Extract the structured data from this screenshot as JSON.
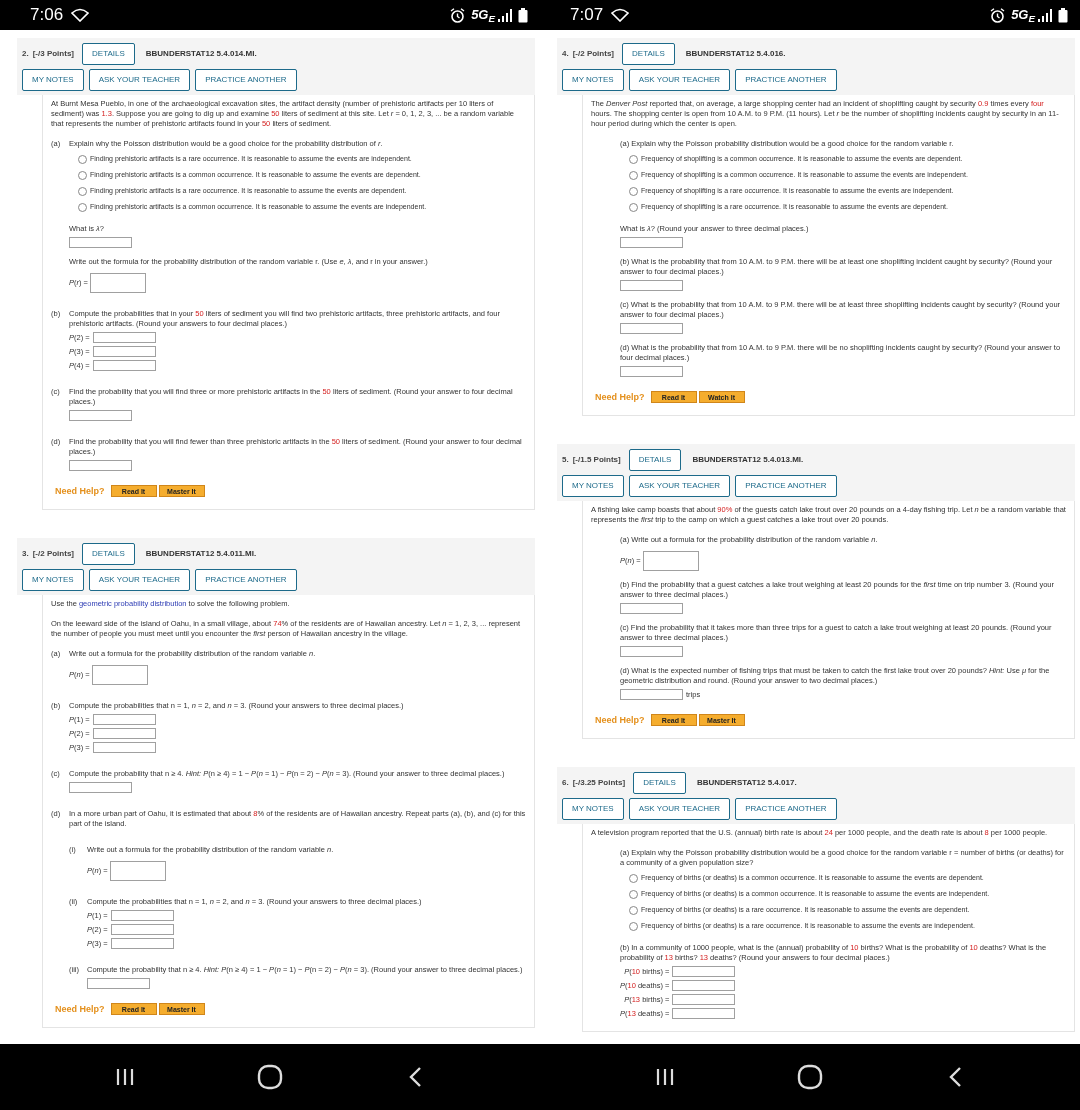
{
  "columns": [
    {
      "status_bar": {
        "time": "7:06",
        "network": "5G$_{E}$"
      },
      "problems": [
        {
          "number": "2.",
          "points": "[-/3 Points]",
          "details": "DETAILS",
          "code": "BBUNDERSTAT12 5.4.014.MI.",
          "buttons": [
            "MY NOTES",
            "ASK YOUR TEACHER",
            "PRACTICE ANOTHER"
          ],
          "intro": [
            [
              "At Burnt Mesa Pueblo, in one of the archaeological excavation sites, the artifact density (number of prehistoric artifacts per 10 liters of sediment) was ",
              {
                "kind": "red",
                "text": "1.3"
              },
              ". Suppose you are going to dig up and examine ",
              {
                "kind": "red",
                "text": "50"
              },
              " liters of sediment at this site. Let *r* = 0, 1, 2, 3, ... be a random variable that represents the number of prehistoric artifacts found in your ",
              {
                "kind": "red",
                "text": "50"
              },
              " liters of sediment."
            ]
          ],
          "items": [
            {
              "kind": "part",
              "label": "(a)",
              "items": [
                {
                  "kind": "para",
                  "text": "Explain why the Poisson distribution would be a good choice for the probability distribution of *r*."
                },
                {
                  "kind": "radios",
                  "options": [
                    {
                      "text": "Finding prehistoric artifacts is a rare occurrence. It is reasonable to assume the events are independent.",
                      "selected": false
                    },
                    {
                      "text": "Finding prehistoric artifacts is a common occurrence. It is reasonable to assume the events are dependent.",
                      "selected": false
                    },
                    {
                      "text": "Finding prehistoric artifacts is a rare occurrence. It is reasonable to assume the events are dependent.",
                      "selected": false
                    },
                    {
                      "text": "Finding prehistoric artifacts is a common occurrence. It is reasonable to assume the events are independent.",
                      "selected": false
                    }
                  ]
                },
                {
                  "kind": "para",
                  "text": "What is *λ*?"
                },
                {
                  "kind": "field"
                },
                {
                  "kind": "para",
                  "text": "Write out the formula for the probability distribution of the random variable r. (Use *e*, *λ*, and r in your answer.)"
                },
                {
                  "kind": "formula",
                  "prefix": "*P*(*r*) ="
                }
              ]
            },
            {
              "kind": "part",
              "label": "(b)",
              "items": [
                {
                  "kind": "para",
                  "text": [
                    "Compute the probabilities that in your ",
                    {
                      "kind": "red",
                      "text": "50"
                    },
                    " liters of sediment you will find two prehistoric artifacts, three prehistoric artifacts, and four prehistoric artifacts. (Round your answers to four decimal places.)"
                  ]
                },
                {
                  "kind": "fields",
                  "rows": [
                    "*P*(2) =",
                    "*P*(3) =",
                    "*P*(4) ="
                  ]
                }
              ]
            },
            {
              "kind": "part",
              "label": "(c)",
              "items": [
                {
                  "kind": "para",
                  "text": [
                    "Find the probability that you will find three or more prehistoric artifacts in the ",
                    {
                      "kind": "red",
                      "text": "50"
                    },
                    " liters of sediment. (Round your answer to four decimal places.)"
                  ]
                },
                {
                  "kind": "field"
                }
              ]
            },
            {
              "kind": "part",
              "label": "(d)",
              "items": [
                {
                  "kind": "para",
                  "text": [
                    "Find the probability that you will find fewer than three prehistoric artifacts in the ",
                    {
                      "kind": "red",
                      "text": "50"
                    },
                    " liters of sediment. (Round your answer to four decimal places.)"
                  ]
                },
                {
                  "kind": "field"
                }
              ]
            }
          ],
          "help": {
            "label": "Need Help?",
            "buttons": [
              "Read It",
              "Master It"
            ]
          }
        },
        {
          "number": "3.",
          "points": "[-/2 Points]",
          "details": "DETAILS",
          "code": "BBUNDERSTAT12 5.4.011.MI.",
          "buttons": [
            "MY NOTES",
            "ASK YOUR TEACHER",
            "PRACTICE ANOTHER"
          ],
          "intro": [
            [
              "Use the ",
              {
                "kind": "link",
                "text": "geometric probability distribution"
              },
              " to solve the following problem."
            ],
            [
              "On the leeward side of the island of Oahu, in a small village, about ",
              {
                "kind": "red",
                "text": "74"
              },
              "% of the residents are of Hawaiian ancestry. Let *n* = 1, 2, 3, ... represent the number of people you must meet until you encounter the *first* person of Hawaiian ancestry in the village."
            ]
          ],
          "items": [
            {
              "kind": "part",
              "label": "(a)",
              "items": [
                {
                  "kind": "para",
                  "text": "Write out a formula for the probability distribution of the random variable *n*."
                },
                {
                  "kind": "formula",
                  "prefix": "*P*(*n*) ="
                }
              ]
            },
            {
              "kind": "part",
              "label": "(b)",
              "items": [
                {
                  "kind": "para",
                  "text": "Compute the probabilities that n = 1, *n* = 2, and *n* = 3. (Round your answers to three decimal places.)"
                },
                {
                  "kind": "fields",
                  "rows": [
                    "*P*(1) =",
                    "*P*(2) =",
                    "*P*(3) ="
                  ]
                }
              ]
            },
            {
              "kind": "part",
              "label": "(c)",
              "items": [
                {
                  "kind": "para",
                  "text": "Compute the probability that n ≥ 4. *Hint:* *P*(n ≥ 4) = 1 − *P*(*n* = 1) − *P*(n = 2) − *P*(*n* = 3). (Round your answer to three decimal places.)"
                },
                {
                  "kind": "field"
                }
              ]
            },
            {
              "kind": "part",
              "label": "(d)",
              "items": [
                {
                  "kind": "para",
                  "text": [
                    "In a more urban part of Oahu, it is estimated that about ",
                    {
                      "kind": "red",
                      "text": "8"
                    },
                    "% of the residents are of Hawaiian ancestry. Repeat parts (a), (b), and (c) for this part of the island."
                  ]
                },
                {
                  "kind": "part",
                  "label": "(i)",
                  "items": [
                    {
                      "kind": "para",
                      "text": "Write out a formula for the probability distribution of the random variable *n*."
                    },
                    {
                      "kind": "formula",
                      "prefix": "*P*(*n*) ="
                    }
                  ]
                },
                {
                  "kind": "part",
                  "label": "(ii)",
                  "items": [
                    {
                      "kind": "para",
                      "text": "Compute the probabilities that n = 1, *n* = 2, and *n* = 3. (Round your answers to three decimal places.)"
                    },
                    {
                      "kind": "fields",
                      "rows": [
                        "*P*(1) =",
                        "*P*(2) =",
                        "*P*(3) ="
                      ]
                    }
                  ]
                },
                {
                  "kind": "part",
                  "label": "(iii)",
                  "items": [
                    {
                      "kind": "para",
                      "text": "Compute the probability that n ≥ 4. *Hint:* *P*(n ≥ 4) = 1 − *P*(*n* = 1) − *P*(n = 2) − *P*(*n* = 3). (Round your answer to three decimal places.)"
                    },
                    {
                      "kind": "field"
                    }
                  ]
                }
              ]
            }
          ],
          "help": {
            "label": "Need Help?",
            "buttons": [
              "Read It",
              "Master It"
            ]
          }
        }
      ]
    },
    {
      "status_bar": {
        "time": "7:07",
        "network": "5G$_{E}$"
      },
      "problems": [
        {
          "number": "4.",
          "points": "[-/2 Points]",
          "details": "DETAILS",
          "code": "BBUNDERSTAT12 5.4.016.",
          "buttons": [
            "MY NOTES",
            "ASK YOUR TEACHER",
            "PRACTICE ANOTHER"
          ],
          "intro": [
            [
              "The *Denver Post* reported that, on average, a large shopping center had an incident of shoplifting caught by security ",
              {
                "kind": "red",
                "text": "0.9"
              },
              " times every ",
              {
                "kind": "red",
                "text": "four"
              },
              " hours. The shopping center is open from 10 A.M. to 9 P.M. (11 hours). Let *r* be the number of shoplifting incidents caught by security in an 11-hour period during which the center is open."
            ]
          ],
          "items": [
            {
              "kind": "part",
              "items": [
                {
                  "kind": "para",
                  "text": "(a) Explain why the Poisson probability distribution would be a good choice for the random variable r."
                },
                {
                  "kind": "radios",
                  "options": [
                    {
                      "text": "Frequency of shoplifting is a common occurrence. It is reasonable to assume the events are dependent.",
                      "selected": false
                    },
                    {
                      "text": "Frequency of shoplifting is a common occurrence. It is reasonable to assume the events are independent.",
                      "selected": false
                    },
                    {
                      "text": "Frequency of shoplifting is a rare occurrence. It is reasonable to assume the events are independent.",
                      "selected": false
                    },
                    {
                      "text": "Frequency of shoplifting is a rare occurrence. It is reasonable to assume the events are dependent.",
                      "selected": false
                    }
                  ]
                },
                {
                  "kind": "para",
                  "text": "What is *λ*? (Round your answer to three decimal places.)"
                },
                {
                  "kind": "field"
                },
                {
                  "kind": "para",
                  "text": "(b) What is the probability that from 10 A.M. to 9 P.M. there will be at least one shoplifting incident caught by security? (Round your answer to four decimal places.)"
                },
                {
                  "kind": "field"
                },
                {
                  "kind": "para",
                  "text": "(c) What is the probability that from 10 A.M. to 9 P.M. there will be at least three shoplifting incidents caught by security? (Round your answer to four decimal places.)"
                },
                {
                  "kind": "field"
                },
                {
                  "kind": "para",
                  "text": "(d) What is the probability that from 10 A.M. to 9 P.M. there will be no shoplifting incidents caught by security? (Round your answer to four decimal places.)"
                },
                {
                  "kind": "field"
                }
              ]
            }
          ],
          "help": {
            "label": "Need Help?",
            "buttons": [
              "Read It",
              "Watch It"
            ]
          }
        },
        {
          "number": "5.",
          "points": "[-/1.5 Points]",
          "details": "DETAILS",
          "code": "BBUNDERSTAT12 5.4.013.MI.",
          "buttons": [
            "MY NOTES",
            "ASK YOUR TEACHER",
            "PRACTICE ANOTHER"
          ],
          "intro": [
            [
              "A fishing lake camp boasts that about ",
              {
                "kind": "red",
                "text": "90%"
              },
              " of the guests catch lake trout over 20 pounds on a 4-day fishing trip. Let *n* be a random variable that represents the *first* trip to the camp on which a guest catches a lake trout over 20 pounds."
            ]
          ],
          "items": [
            {
              "kind": "part",
              "items": [
                {
                  "kind": "para",
                  "text": "(a) Write out a formula for the probability distribution of the random variable *n*."
                },
                {
                  "kind": "formula",
                  "prefix": "*P*(*n*) ="
                },
                {
                  "kind": "para",
                  "text": "(b) Find the probability that a guest catches a lake trout weighing at least 20 pounds for the *first* time on trip number 3. (Round your answer to three decimal places.)"
                },
                {
                  "kind": "field"
                },
                {
                  "kind": "para",
                  "text": "(c) Find the probability that it takes more than three trips for a guest to catch a lake trout weighing at least 20 pounds. (Round your answer to three decimal places.)"
                },
                {
                  "kind": "field"
                },
                {
                  "kind": "para",
                  "text": "(d) What is the expected number of fishing trips that must be taken to catch the first lake trout over 20 pounds? *Hint:* Use *μ* for the geometric distribution and round. (Round your answer to two decimal places.)"
                },
                {
                  "kind": "field",
                  "suffix": "trips"
                }
              ]
            }
          ],
          "help": {
            "label": "Need Help?",
            "buttons": [
              "Read It",
              "Master It"
            ]
          }
        },
        {
          "number": "6.",
          "points": "[-/3.25 Points]",
          "details": "DETAILS",
          "code": "BBUNDERSTAT12 5.4.017.",
          "buttons": [
            "MY NOTES",
            "ASK YOUR TEACHER",
            "PRACTICE ANOTHER"
          ],
          "intro": [
            [
              "A television program reported that the U.S. (annual) birth rate is about ",
              {
                "kind": "red",
                "text": "24"
              },
              " per 1000 people, and the death rate is about ",
              {
                "kind": "red",
                "text": "8"
              },
              " per 1000 people."
            ]
          ],
          "items": [
            {
              "kind": "part",
              "items": [
                {
                  "kind": "para",
                  "text": "(a) Explain why the Poisson probability distribution would be a good choice for the random variable r = number of births (or deaths) for a community of a given population size?"
                },
                {
                  "kind": "radios",
                  "options": [
                    {
                      "text": "Frequency of births (or deaths) is a common occurrence. It is reasonable to assume the events are dependent.",
                      "selected": false
                    },
                    {
                      "text": "Frequency of births (or deaths) is a common occurrence. It is reasonable to assume the events are independent.",
                      "selected": false
                    },
                    {
                      "text": "Frequency of births (or deaths) is a rare occurrence. It is reasonable to assume the events are dependent.",
                      "selected": false
                    },
                    {
                      "text": "Frequency of births (or deaths) is a rare occurrence. It is reasonable to assume the events are independent.",
                      "selected": false
                    }
                  ]
                },
                {
                  "kind": "para",
                  "text": [
                    "(b) In a community of 1000 people, what is the (annual) probability of ",
                    {
                      "kind": "red",
                      "text": "10"
                    },
                    " births? What is the probability of ",
                    {
                      "kind": "red",
                      "text": "10"
                    },
                    " deaths? What is the probability of ",
                    {
                      "kind": "red",
                      "text": "13"
                    },
                    " births? ",
                    {
                      "kind": "red",
                      "text": "13"
                    },
                    " deaths? (Round your answers to four decimal places.)"
                  ]
                },
                {
                  "kind": "fields",
                  "rows": [
                    [
                      "*P*(",
                      {
                        "kind": "red",
                        "text": "10"
                      },
                      " births) ="
                    ],
                    [
                      "*P*(",
                      {
                        "kind": "red",
                        "text": "10"
                      },
                      " deaths) ="
                    ],
                    [
                      "*P*(",
                      {
                        "kind": "red",
                        "text": "13"
                      },
                      " births) ="
                    ],
                    [
                      "*P*(",
                      {
                        "kind": "red",
                        "text": "13"
                      },
                      " deaths) ="
                    ]
                  ]
                }
              ]
            }
          ]
        }
      ]
    }
  ]
}
